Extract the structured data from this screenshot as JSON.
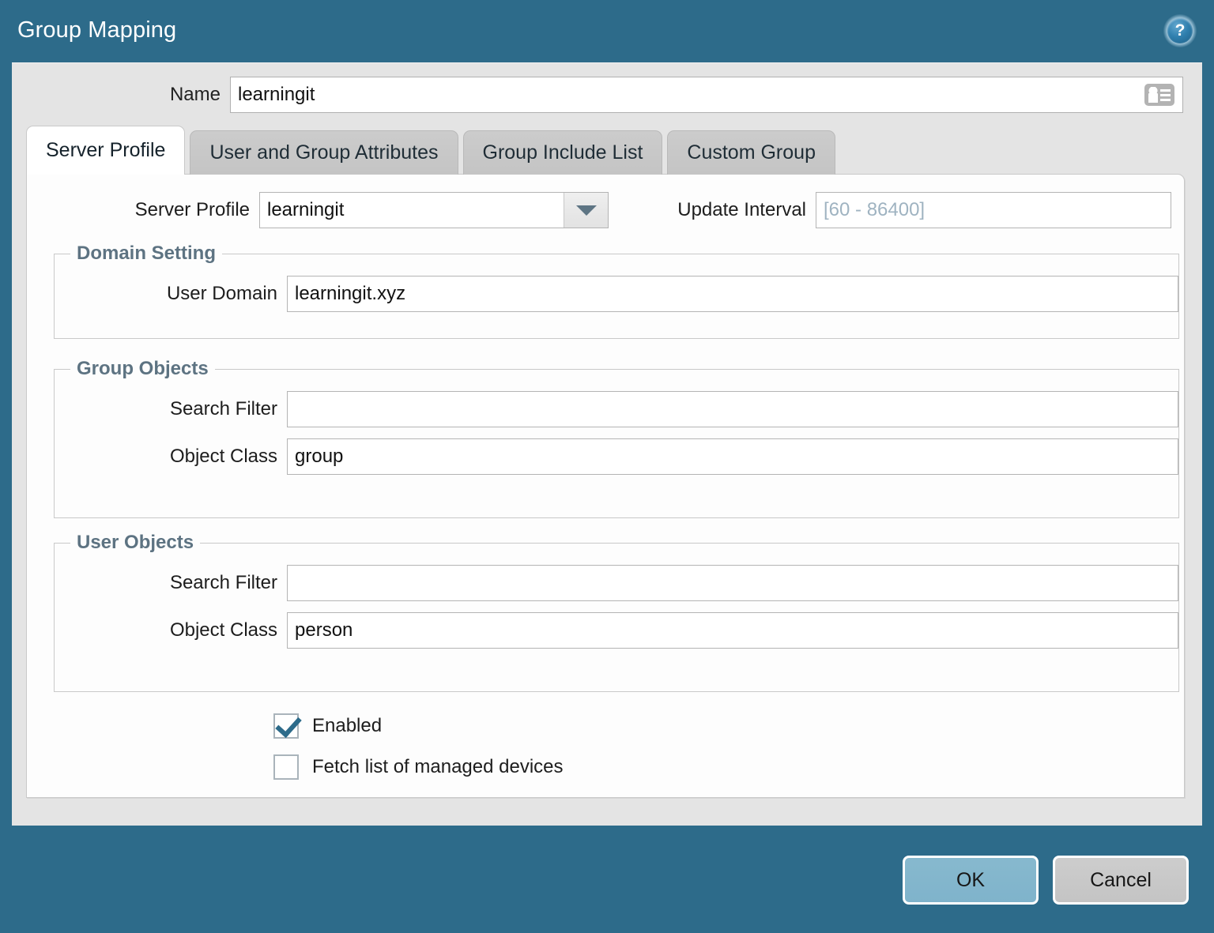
{
  "window": {
    "title": "Group Mapping",
    "help_icon": "help-circle-icon",
    "help_glyph": "?"
  },
  "name_field": {
    "label": "Name",
    "value": "learningit",
    "placeholder": "",
    "icon": "id-card-icon"
  },
  "tabs": [
    {
      "label": "Server Profile",
      "active": true
    },
    {
      "label": "User and Group Attributes",
      "active": false
    },
    {
      "label": "Group Include List",
      "active": false
    },
    {
      "label": "Custom Group",
      "active": false
    }
  ],
  "server_profile": {
    "label": "Server Profile",
    "value": "learningit",
    "dropdown_icon": "chevron-down-icon"
  },
  "update_interval": {
    "label": "Update Interval",
    "value": "",
    "placeholder": "[60 - 86400]"
  },
  "domain_setting": {
    "legend": "Domain Setting",
    "user_domain_label": "User Domain",
    "user_domain_value": "learningit.xyz",
    "user_domain_placeholder": ""
  },
  "group_objects": {
    "legend": "Group Objects",
    "search_filter_label": "Search Filter",
    "search_filter_value": "",
    "search_filter_placeholder": "",
    "object_class_label": "Object Class",
    "object_class_value": "group",
    "object_class_placeholder": ""
  },
  "user_objects": {
    "legend": "User Objects",
    "search_filter_label": "Search Filter",
    "search_filter_value": "",
    "search_filter_placeholder": "",
    "object_class_label": "Object Class",
    "object_class_value": "person",
    "object_class_placeholder": ""
  },
  "checkboxes": [
    {
      "label": "Enabled",
      "checked": true
    },
    {
      "label": "Fetch list of managed devices",
      "checked": false
    }
  ],
  "footer": {
    "ok_label": "OK",
    "cancel_label": "Cancel"
  },
  "colors": {
    "dialog_background": "#2d6b8a",
    "panel_background": "#e4e4e4",
    "content_background": "#fdfdfd",
    "legend_text": "#5d7382",
    "placeholder_text": "#9fb3c1",
    "ok_button": "#87b9ce",
    "cancel_button": "#cdcdcd",
    "checkmark": "#2d6b8a"
  }
}
